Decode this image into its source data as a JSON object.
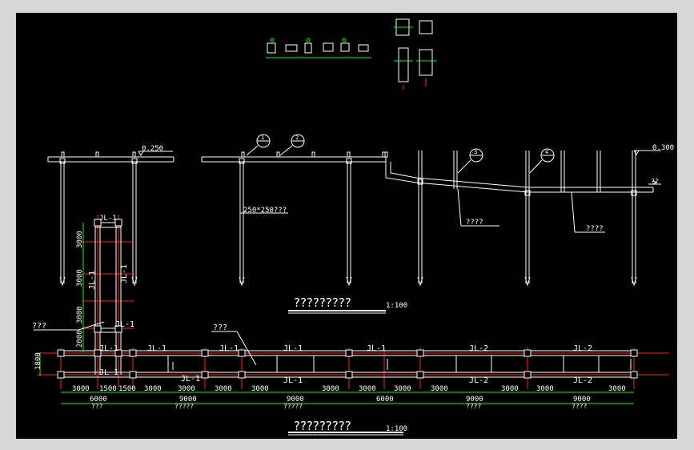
{
  "drawing": {
    "elevation_title": "?????????",
    "elevation_scale": "1:100",
    "plan_title": "?????????",
    "plan_scale": "1:100",
    "level_left": "0.250",
    "level_right": "0.300",
    "slope_mark": "??",
    "column_note": "250*250???",
    "elev_note_1": "????",
    "elev_note_2": "????",
    "plan_note_1": "???",
    "plan_note_2": "???",
    "detail_numbers": [
      "1",
      "2",
      "3",
      "4"
    ]
  },
  "plan": {
    "beam_labels_top": [
      "JL-1",
      "JL-1",
      "JL-1",
      "JL-1",
      "JL-1",
      "JL-2",
      "JL-2"
    ],
    "beam_labels_bottom": [
      "JL-1",
      "JL-1",
      "JL-1",
      "JL-2",
      "JL-2"
    ],
    "vertical_beam_labels": [
      "JL-1",
      "JL-1",
      "JL-1",
      "JL-1"
    ],
    "top_vertical_label": "JL-1",
    "dims_vertical": [
      "3000",
      "3000",
      "3000",
      "2000"
    ],
    "dim_width": "1800",
    "dims_row1": [
      "3000",
      "1500",
      "1500",
      "3000",
      "3000",
      "3000",
      "3000",
      "3000",
      "3000",
      "3000",
      "3000",
      "3000",
      "3000",
      "3000"
    ],
    "dims_row2": [
      "6000",
      "9000",
      "9000",
      "6000",
      "9000",
      "9000"
    ],
    "dims_row3": [
      "???",
      "?????",
      "?????",
      "????",
      "????"
    ]
  }
}
